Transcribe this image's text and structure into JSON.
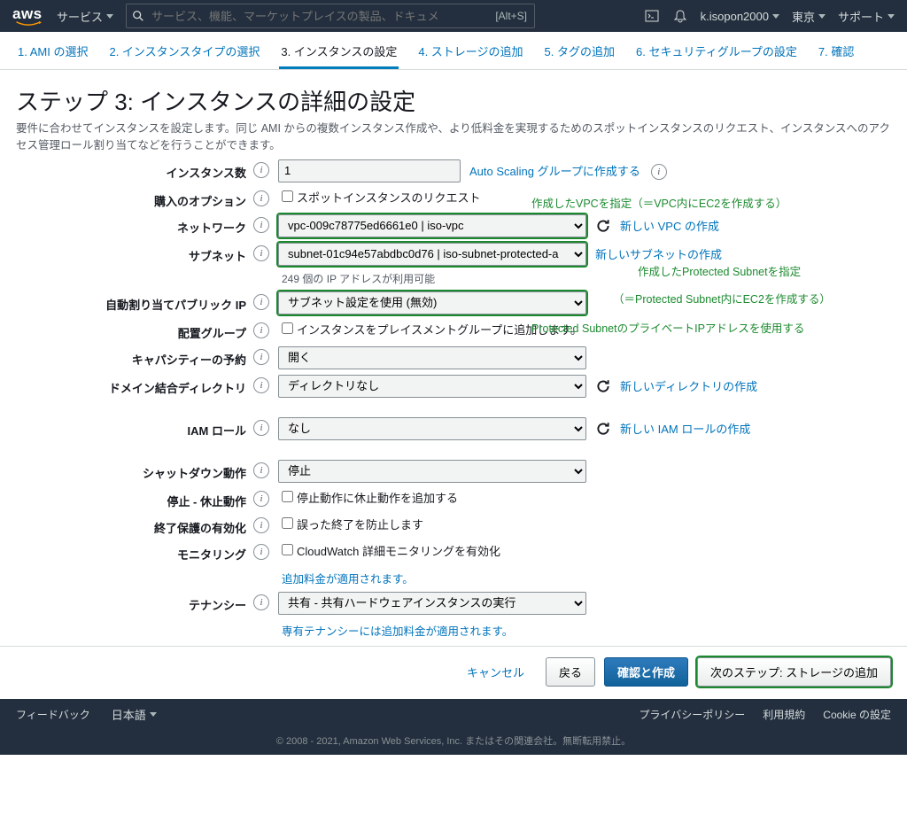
{
  "topnav": {
    "services": "サービス",
    "search_placeholder": "サービス、機能、マーケットプレイスの製品、ドキュメ",
    "search_hint": "[Alt+S]",
    "user": "k.isopon2000",
    "region": "東京",
    "support": "サポート"
  },
  "wizard": {
    "steps": [
      "1. AMI の選択",
      "2. インスタンスタイプの選択",
      "3. インスタンスの設定",
      "4. ストレージの追加",
      "5. タグの追加",
      "6. セキュリティグループの設定",
      "7. 確認"
    ],
    "active": 2
  },
  "page": {
    "title": "ステップ 3: インスタンスの詳細の設定",
    "desc": "要件に合わせてインスタンスを設定します。同じ AMI からの複数インスタンス作成や、より低料金を実現するためのスポットインスタンスのリクエスト、インスタンスへのアクセス管理ロール割り当てなどを行うことができます。"
  },
  "form": {
    "count_label": "インスタンス数",
    "count_value": "1",
    "count_link": "Auto Scaling グループに作成する",
    "purchase_label": "購入のオプション",
    "purchase_cb": "スポットインスタンスのリクエスト",
    "network_label": "ネットワーク",
    "network_value": "vpc-009c78775ed6661e0 | iso-vpc",
    "network_link": "新しい VPC の作成",
    "subnet_label": "サブネット",
    "subnet_value": "subnet-01c94e57abdbc0d76 | iso-subnet-protected-a",
    "subnet_note": "249 個の IP アドレスが利用可能",
    "subnet_link": "新しいサブネットの作成",
    "autoip_label": "自動割り当てパブリック IP",
    "autoip_value": "サブネット設定を使用 (無効)",
    "placement_label": "配置グループ",
    "placement_cb": "インスタンスをプレイスメントグループに追加します。",
    "capacity_label": "キャパシティーの予約",
    "capacity_value": "開く",
    "directory_label": "ドメイン結合ディレクトリ",
    "directory_value": "ディレクトリなし",
    "directory_link": "新しいディレクトリの作成",
    "iam_label": "IAM ロール",
    "iam_value": "なし",
    "iam_link": "新しい IAM ロールの作成",
    "shutdown_label": "シャットダウン動作",
    "shutdown_value": "停止",
    "stophib_label": "停止 - 休止動作",
    "stophib_cb": "停止動作に休止動作を追加する",
    "termprot_label": "終了保護の有効化",
    "termprot_cb": "誤った終了を防止します",
    "monitoring_label": "モニタリング",
    "monitoring_cb": "CloudWatch 詳細モニタリングを有効化",
    "monitoring_note": "追加料金が適用されます。",
    "tenancy_label": "テナンシー",
    "tenancy_value": "共有 - 共有ハードウェアインスタンスの実行",
    "tenancy_note": "専有テナンシーには追加料金が適用されます。"
  },
  "annotations": {
    "a1": "作成したVPCを指定（＝VPC内にEC2を作成する）",
    "a2": "作成したProtected Subnetを指定",
    "a3": "（＝Protected Subnet内にEC2を作成する）",
    "a4": "Protected SubnetのプライベートIPアドレスを使用する"
  },
  "footer": {
    "cancel": "キャンセル",
    "back": "戻る",
    "review": "確認と作成",
    "next": "次のステップ: ストレージの追加"
  },
  "bottom": {
    "feedback": "フィードバック",
    "lang": "日本語",
    "privacy": "プライバシーポリシー",
    "terms": "利用規約",
    "cookies": "Cookie の設定",
    "legal": "© 2008 - 2021, Amazon Web Services, Inc. またはその関連会社。無断転用禁止。"
  }
}
